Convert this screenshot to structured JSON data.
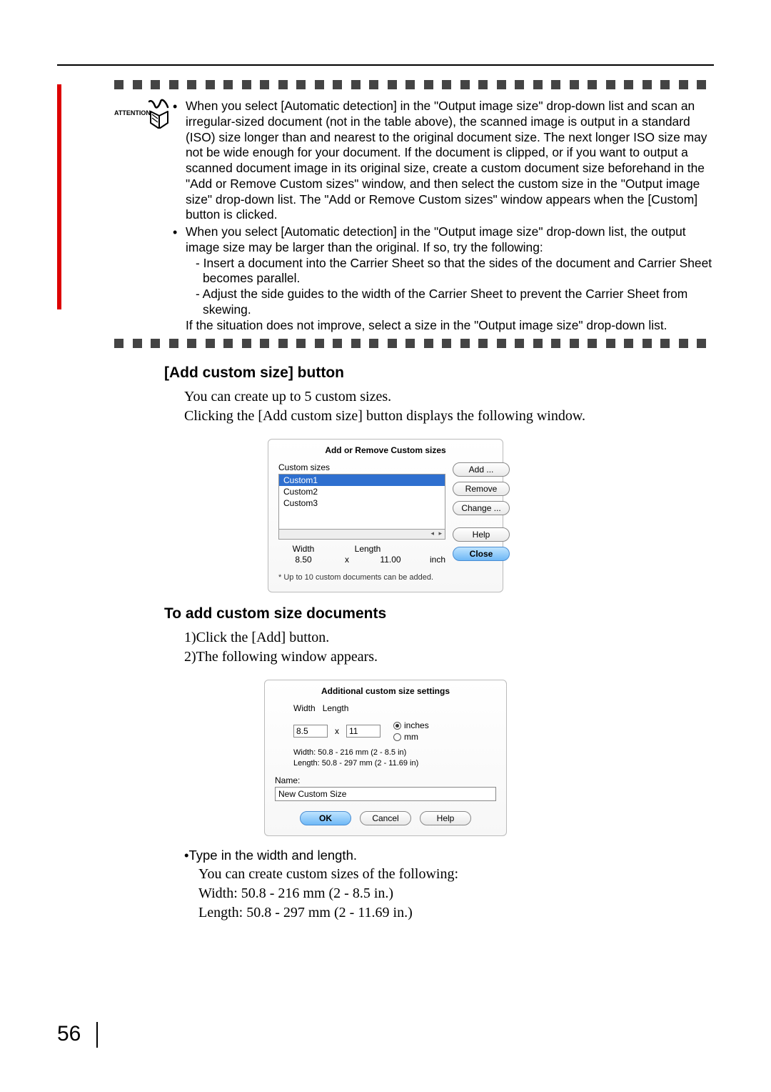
{
  "attention": {
    "label": "ATTENTION",
    "bullet1": "When you select [Automatic detection] in the \"Output image size\" drop-down list and scan an irregular-sized document (not in the table above), the scanned image is output in a standard (ISO) size longer than and nearest to the original document size. The next longer ISO size may not be wide enough for your document. If the document is clipped, or if you want to output a scanned document image in its original size, create a custom document size beforehand in the \"Add or Remove Custom sizes\" window, and then select the custom size in the \"Output image size\" drop-down list. The \"Add or Remove Custom sizes\" window appears when the [Custom] button is clicked.",
    "bullet2": "When you select [Automatic detection] in the \"Output image size\" drop-down list, the output image size may be larger than the original. If so, try the following:",
    "sub1": "- Insert a document into the Carrier Sheet so that the sides of the document and Carrier Sheet becomes parallel.",
    "sub2": "- Adjust the side guides to the width of the Carrier Sheet to prevent the Carrier Sheet from skewing.",
    "closing": "If the situation does not improve, select a size in the \"Output image size\" drop-down list."
  },
  "section1": {
    "heading": "[Add custom size] button",
    "line1": "You can create up to 5 custom sizes.",
    "line2": "Clicking the [Add custom size] button displays the following window."
  },
  "dialog1": {
    "title": "Add or Remove Custom sizes",
    "list_label": "Custom sizes",
    "items": [
      "Custom1",
      "Custom2",
      "Custom3"
    ],
    "width_label": "Width",
    "length_label": "Length",
    "width_val": "8.50",
    "length_val": "11.00",
    "unit": "inch",
    "note": "* Up to 10 custom documents can be added.",
    "btn_add": "Add ...",
    "btn_remove": "Remove",
    "btn_change": "Change ...",
    "btn_help": "Help",
    "btn_close": "Close"
  },
  "section2": {
    "heading": "To add custom size documents",
    "step1": "1)Click the [Add] button.",
    "step2": "2)The following window appears."
  },
  "dialog2": {
    "title": "Additional custom size settings",
    "width_label": "Width",
    "length_label": "Length",
    "width_val": "8.5",
    "length_val": "11",
    "unit_in": "inches",
    "unit_mm": "mm",
    "hint_w": "Width: 50.8 - 216 mm (2 - 8.5 in)",
    "hint_l": "Length: 50.8 - 297 mm (2 - 11.69 in)",
    "name_label": "Name:",
    "name_val": "New Custom Size",
    "btn_ok": "OK",
    "btn_cancel": "Cancel",
    "btn_help": "Help"
  },
  "after": {
    "bullet": "•Type in the width and length.",
    "line1": "You can create custom sizes of the following:",
    "line2": "Width: 50.8 - 216 mm (2 - 8.5 in.)",
    "line3": "Length: 50.8 - 297 mm (2 - 11.69 in.)"
  },
  "page_number": "56"
}
